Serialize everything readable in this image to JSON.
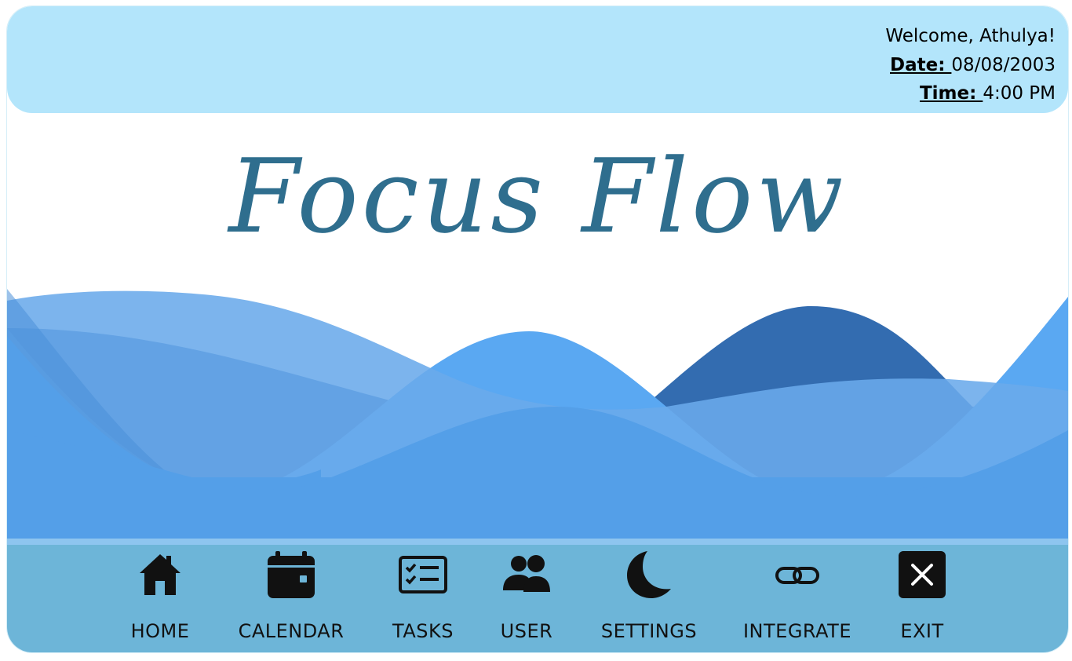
{
  "header": {
    "welcome": "Welcome, Athulya!",
    "date_label": "Date: ",
    "date_value": "08/08/2003",
    "time_label": "Time: ",
    "time_value": "4:00 PM"
  },
  "app": {
    "title": "Focus Flow"
  },
  "nav": {
    "items": [
      {
        "label": "HOME",
        "icon": "home-icon"
      },
      {
        "label": "CALENDAR",
        "icon": "calendar-icon"
      },
      {
        "label": "TASKS",
        "icon": "tasks-icon"
      },
      {
        "label": "USER",
        "icon": "users-icon"
      },
      {
        "label": "SETTINGS",
        "icon": "moon-icon"
      },
      {
        "label": "INTEGRATE",
        "icon": "link-icon"
      },
      {
        "label": "EXIT",
        "icon": "close-icon"
      }
    ]
  },
  "colors": {
    "header_bg": "#b3e5fb",
    "title": "#2f6e8e",
    "nav_bg": "#6db5d8",
    "wave_light": "#7bb6ec",
    "wave_mid": "#5aa8f2",
    "wave_dark": "#336cb0"
  }
}
